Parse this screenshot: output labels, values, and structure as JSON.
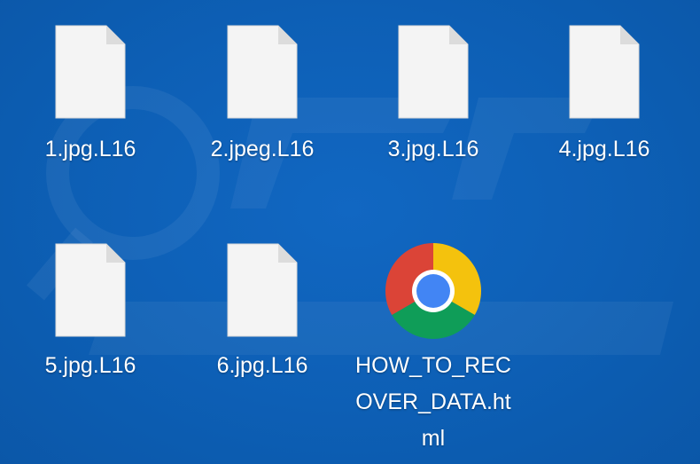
{
  "desktop": {
    "files": [
      {
        "name": "1.jpg.L16",
        "icon": "blank-document-icon"
      },
      {
        "name": "2.jpeg.L16",
        "icon": "blank-document-icon"
      },
      {
        "name": "3.jpg.L16",
        "icon": "blank-document-icon"
      },
      {
        "name": "4.jpg.L16",
        "icon": "blank-document-icon"
      },
      {
        "name": "5.jpg.L16",
        "icon": "blank-document-icon"
      },
      {
        "name": "6.jpg.L16",
        "icon": "blank-document-icon"
      },
      {
        "name": "HOW_TO_REC\nOVER_DATA.ht\nml",
        "icon": "chrome-icon"
      }
    ]
  },
  "colors": {
    "desktop_background": "#0d5fb5",
    "label_text": "#ffffff",
    "document_page": "#f4f4f4",
    "chrome_red": "#db4437",
    "chrome_yellow": "#f4c20d",
    "chrome_green": "#0f9d58",
    "chrome_blue": "#4285f4"
  }
}
